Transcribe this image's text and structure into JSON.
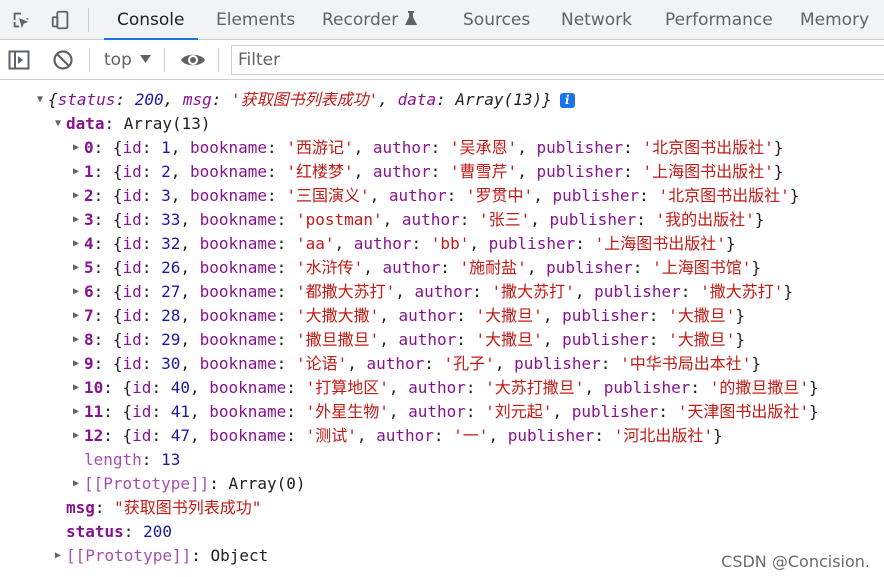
{
  "tabs": [
    {
      "label": "Console",
      "active": true
    },
    {
      "label": "Elements"
    },
    {
      "label": "Recorder"
    },
    {
      "label": "Sources"
    },
    {
      "label": "Network"
    },
    {
      "label": "Performance"
    },
    {
      "label": "Memory"
    }
  ],
  "toolbar": {
    "context": "top",
    "filter_placeholder": "Filter"
  },
  "root_summary": {
    "open": "{",
    "status_key": "status",
    "status_val": "200",
    "msg_key": "msg",
    "msg_val": "'获取图书列表成功'",
    "data_key": "data",
    "data_val": "Array(13)",
    "close": "}"
  },
  "data_label": "data",
  "data_type": "Array(13)",
  "books": [
    {
      "idx": "0",
      "id": "1",
      "bookname": "'西游记'",
      "author": "'吴承恩'",
      "publisher": "'北京图书出版社'"
    },
    {
      "idx": "1",
      "id": "2",
      "bookname": "'红楼梦'",
      "author": "'曹雪芹'",
      "publisher": "'上海图书出版社'"
    },
    {
      "idx": "2",
      "id": "3",
      "bookname": "'三国演义'",
      "author": "'罗贯中'",
      "publisher": "'北京图书出版社'"
    },
    {
      "idx": "3",
      "id": "33",
      "bookname": "'postman'",
      "author": "'张三'",
      "publisher": "'我的出版社'"
    },
    {
      "idx": "4",
      "id": "32",
      "bookname": "'aa'",
      "author": "'bb'",
      "publisher": "'上海图书出版社'"
    },
    {
      "idx": "5",
      "id": "26",
      "bookname": "'水浒传'",
      "author": "'施耐盐'",
      "publisher": "'上海图书馆'"
    },
    {
      "idx": "6",
      "id": "27",
      "bookname": "'都撒大苏打'",
      "author": "'撒大苏打'",
      "publisher": "'撒大苏打'"
    },
    {
      "idx": "7",
      "id": "28",
      "bookname": "'大撒大撒'",
      "author": "'大撒旦'",
      "publisher": "'大撒旦'"
    },
    {
      "idx": "8",
      "id": "29",
      "bookname": "'撒旦撒旦'",
      "author": "'大撒旦'",
      "publisher": "'大撒旦'"
    },
    {
      "idx": "9",
      "id": "30",
      "bookname": "'论语'",
      "author": "'孔子'",
      "publisher": "'中华书局出本社'"
    },
    {
      "idx": "10",
      "id": "40",
      "bookname": "'打算地区'",
      "author": "'大苏打撒旦'",
      "publisher": "'的撒旦撒旦'"
    },
    {
      "idx": "11",
      "id": "41",
      "bookname": "'外星生物'",
      "author": "'刘元起'",
      "publisher": "'天津图书出版社'"
    },
    {
      "idx": "12",
      "id": "47",
      "bookname": "'测试'",
      "author": "'一'",
      "publisher": "'河北出版社'"
    }
  ],
  "field_keys": {
    "id": "id",
    "bookname": "bookname",
    "author": "author",
    "publisher": "publisher"
  },
  "length_key": "length",
  "length_val": "13",
  "array_proto_key": "[[Prototype]]",
  "array_proto_val": "Array(0)",
  "msg_key": "msg",
  "msg_val": "\"获取图书列表成功\"",
  "status_key": "status",
  "status_val": "200",
  "obj_proto_key": "[[Prototype]]",
  "obj_proto_val": "Object",
  "info_icon_text": "i",
  "watermark": "CSDN @Concision."
}
